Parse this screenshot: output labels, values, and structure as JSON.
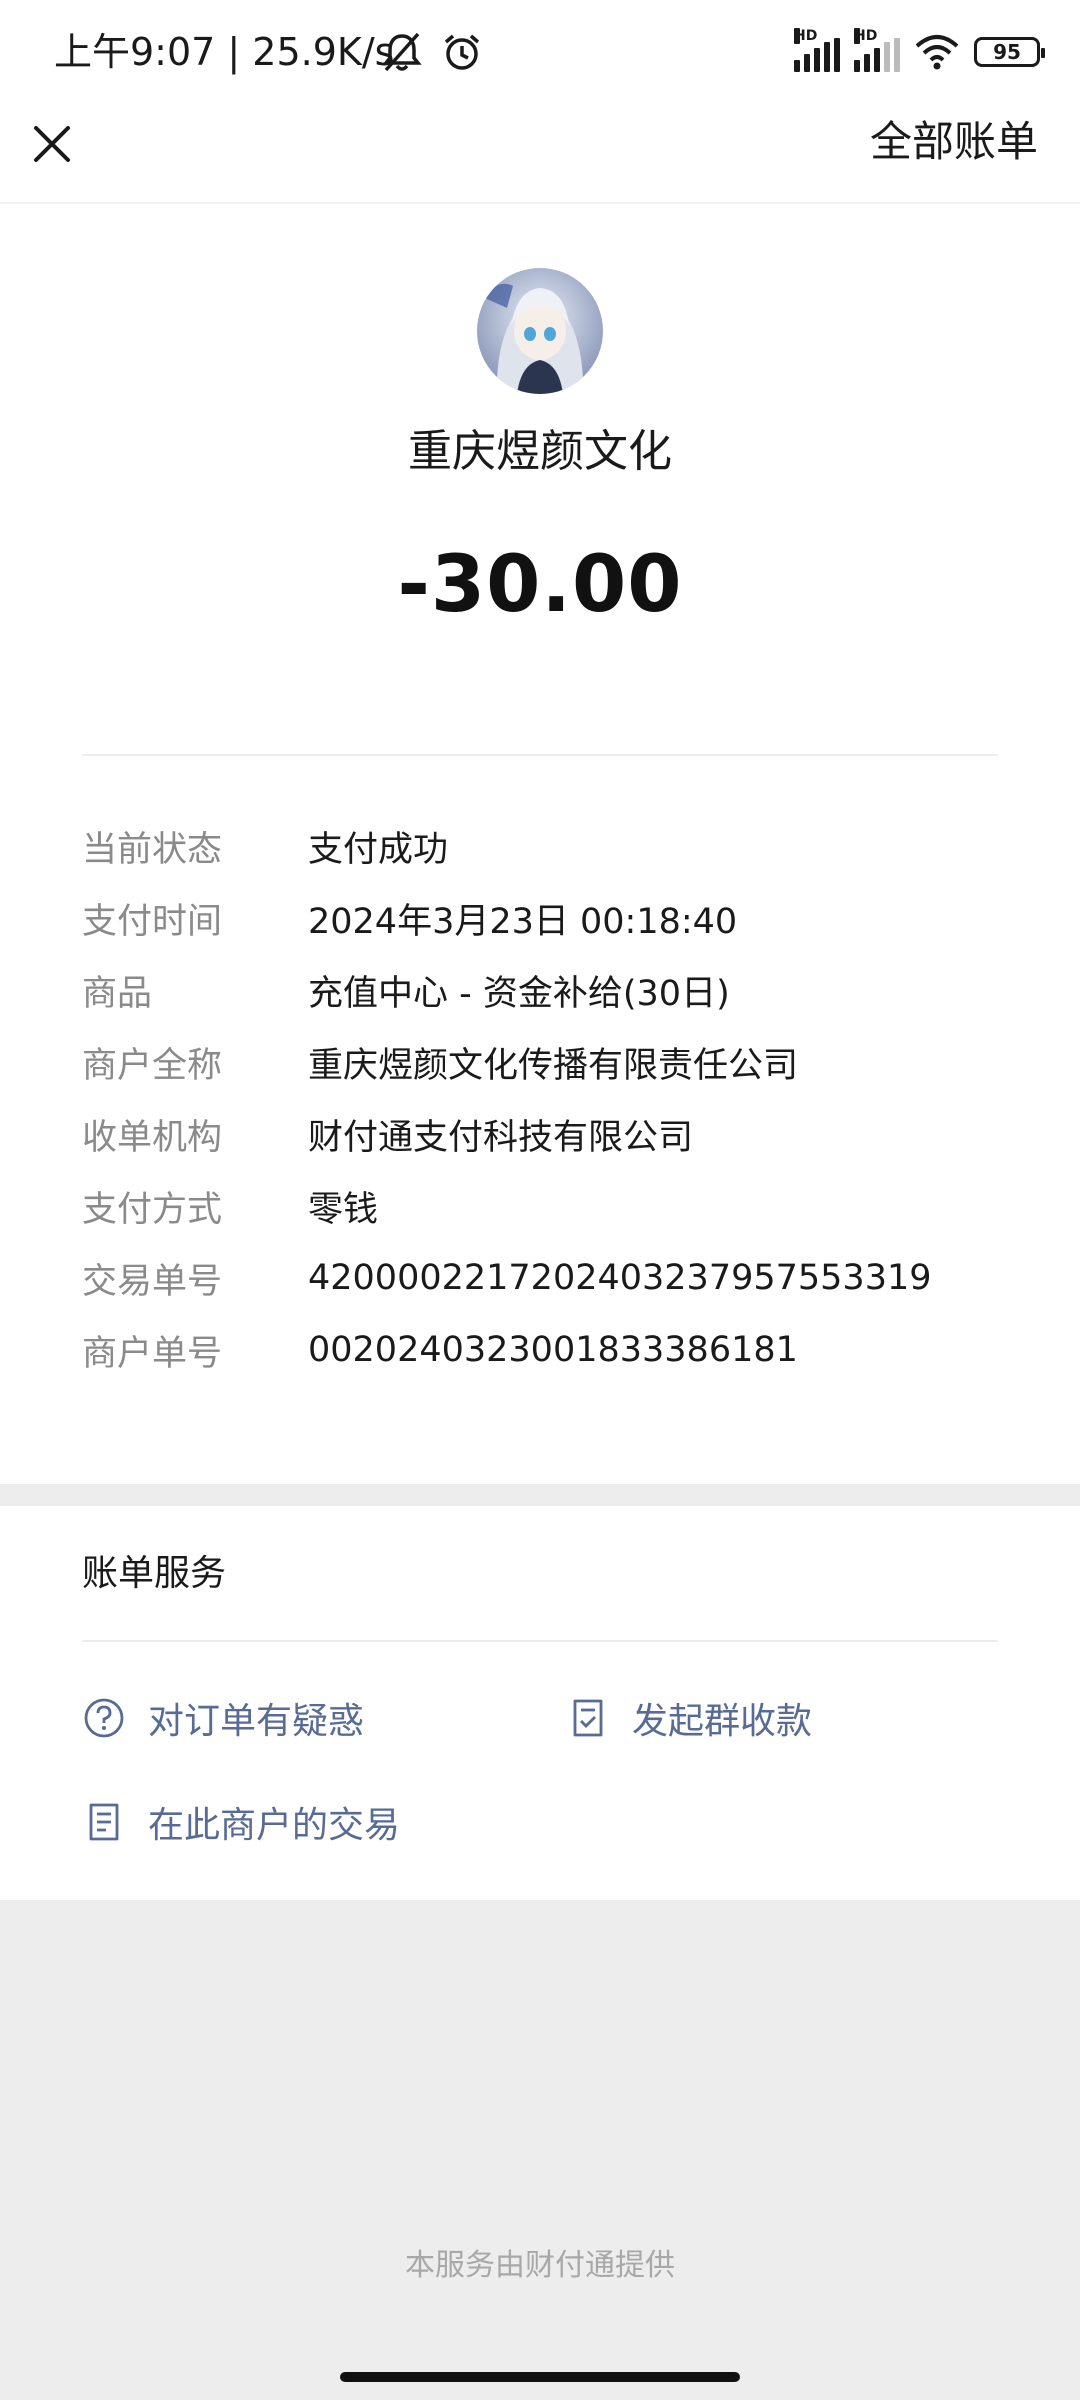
{
  "status_bar": {
    "time": "上午9:07 | 25.9K/s",
    "signal_1_label": "HD",
    "signal_2_label": "HD",
    "battery": "95",
    "icons": [
      "mute-icon",
      "alarm-icon",
      "signal-icon",
      "signal-icon",
      "wifi-icon",
      "battery-icon"
    ]
  },
  "nav": {
    "close_icon": "close-icon",
    "all_bills_label": "全部账单"
  },
  "header": {
    "merchant_name": "重庆煜颜文化",
    "amount": "-30.00"
  },
  "details": [
    {
      "label": "当前状态",
      "value": "支付成功"
    },
    {
      "label": "支付时间",
      "value": "2024年3月23日 00:18:40"
    },
    {
      "label": "商品",
      "value": "充值中心 - 资金补给(30日)"
    },
    {
      "label": "商户全称",
      "value": "重庆煜颜文化传播有限责任公司"
    },
    {
      "label": "收单机构",
      "value": "财付通支付科技有限公司"
    },
    {
      "label": "支付方式",
      "value": "零钱"
    },
    {
      "label": "交易单号",
      "value": "4200002217202403237957553319"
    },
    {
      "label": "商户单号",
      "value": "0020240323001833386181"
    }
  ],
  "services": {
    "title": "账单服务",
    "items": [
      {
        "label": "对订单有疑惑",
        "icon": "question-circle-icon"
      },
      {
        "label": "发起群收款",
        "icon": "group-collect-icon"
      },
      {
        "label": "在此商户的交易",
        "icon": "document-icon"
      }
    ]
  },
  "footer": {
    "text": "本服务由财付通提供"
  },
  "colors": {
    "link": "#576b95",
    "label_gray": "#8a8a8a",
    "background_gray": "#ededed"
  }
}
